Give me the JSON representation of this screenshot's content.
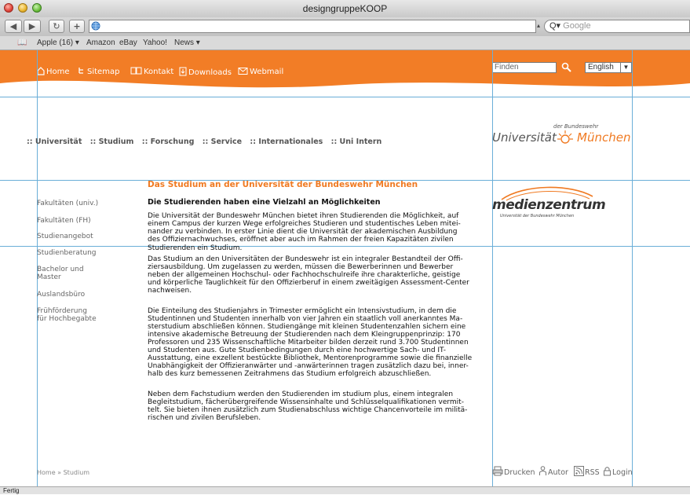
{
  "window": {
    "title": "designgruppeKOOP"
  },
  "toolbar": {
    "search_placeholder": "Google"
  },
  "bookmarks": [
    "Apple (16) ▾",
    "Amazon",
    "eBay",
    "Yahoo!",
    "News ▾"
  ],
  "header_nav": [
    "Home",
    "Sitemap",
    "Kontakt",
    "Downloads",
    "Webmail"
  ],
  "search": {
    "placeholder": "Finden"
  },
  "language": {
    "selected": "English"
  },
  "main_nav": [
    ":: Universität",
    ":: Studium",
    ":: Forschung",
    ":: Service",
    ":: Internationales",
    ":: Uni Intern"
  ],
  "logo_uni": {
    "small": "der Bundeswehr",
    "left": "Universität",
    "right": "München"
  },
  "logo_medien": {
    "word": "medienzentrum",
    "sub": "Universität der Bundeswehr München"
  },
  "content": {
    "heading": "Das Studium an der Universität der Bundeswehr München",
    "subheading": "Die Studierenden haben eine Vielzahl an Möglichkeiten",
    "paragraphs": [
      [
        "Die Universität der Bundeswehr München bietet ihren Studierenden die Möglichkeit, auf",
        "einem Campus der kurzen Wege erfolgreiches Studieren und studentisches Leben mitei-",
        "nander zu verbinden. In erster Linie dient die Universität der akademischen Ausbildung",
        "des Offiziernachwuchses, eröffnet aber auch im Rahmen der freien Kapazitäten zivilen",
        "Studierenden ein Studium."
      ],
      [
        "Das Studium an den Universitäten der Bundeswehr ist ein integraler Bestandteil der Offi-",
        "ziersausbildung. Um zugelassen zu werden, müssen die Bewerberinnen und Bewerber",
        "neben der allgemeinen Hochschul- oder Fachhochschulreife ihre charakterliche, geistige",
        "und körperliche Tauglichkeit für den Offizierberuf in einem zweitägigen Assessment-Center",
        "nachweisen."
      ],
      [
        "Die Einteilung des Studienjahrs in Trimester ermöglicht ein Intensivstudium, in dem die",
        "Studentinnen und Studenten innerhalb von vier Jahren ein staatlich voll anerkanntes Ma-",
        "sterstudium abschließen können. Studiengänge mit kleinen Studentenzahlen sichern eine",
        "intensive akademische Betreuung der Studierenden nach dem Kleingruppenprinzip: 170",
        "Professoren und 235 Wissenschaftliche Mitarbeiter bilden derzeit rund 3.700 Studentinnen",
        "und Studenten aus. Gute Studienbedingungen durch eine hochwertige Sach- und IT-",
        "Ausstattung, eine exzellent bestückte Bibliothek, Mentorenprogramme sowie die finanzielle",
        "Unabhängigkeit der Offizieranwärter und -anwärterinnen tragen zusätzlich dazu bei, inner-",
        "halb des kurz bemessenen Zeitrahmens das Studium erfolgreich abzuschließen."
      ],
      [
        "Neben dem Fachstudium werden den Studierenden im studium plus, einem integralen",
        "Begleitstudium, fächerübergreifende Wissensinhalte und Schlüsselqualifikationen vermit-",
        "telt. Sie bieten ihnen zusätzlich zum Studienabschluss wichtige Chancenvorteile im militä-",
        "rischen und zivilen Berufsleben."
      ]
    ]
  },
  "sidebar": [
    [
      "Fakultäten (univ.)"
    ],
    [
      "Fakultäten (FH)"
    ],
    [
      "Studienangebot"
    ],
    [
      "Studienberatung"
    ],
    [
      "Bachelor und",
      "Master"
    ],
    [
      "Auslandsbüro"
    ],
    [
      "Frühförderung",
      "für Hochbegabte"
    ]
  ],
  "breadcrumb": "Home » Studium",
  "tools": [
    "Drucken",
    "Autor",
    "RSS",
    "Login"
  ],
  "status": "Fertig",
  "colors": {
    "accent": "#f27d26",
    "guide": "#6aaed8",
    "heading": "#f07a22"
  }
}
